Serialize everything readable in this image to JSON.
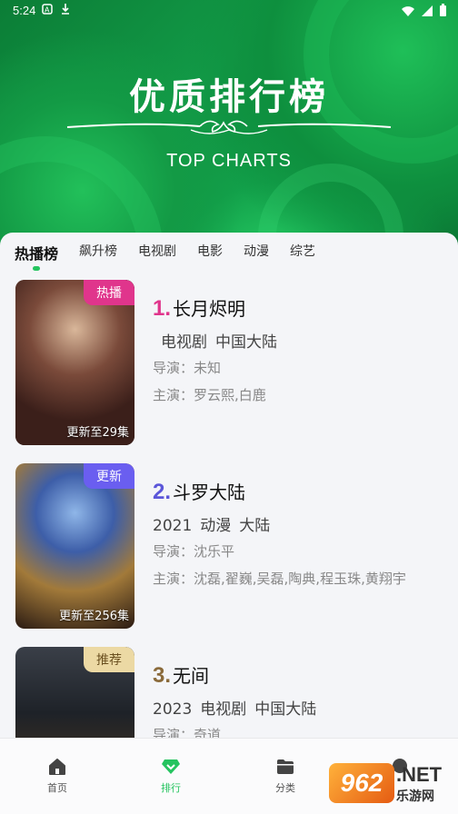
{
  "status_bar": {
    "time": "5:24"
  },
  "banner": {
    "title": "优质排行榜",
    "subtitle": "TOP CHARTS"
  },
  "tabs": [
    {
      "label": "热播榜",
      "active": true
    },
    {
      "label": "飙升榜",
      "active": false
    },
    {
      "label": "电视剧",
      "active": false
    },
    {
      "label": "电影",
      "active": false
    },
    {
      "label": "动漫",
      "active": false
    },
    {
      "label": "综艺",
      "active": false
    }
  ],
  "items": [
    {
      "rank": "1.",
      "title": "长月烬明",
      "rank_color": "#e0358c",
      "badge": "热播",
      "badge_color": "#e0358c",
      "update": "更新至29集",
      "meta": [
        "",
        "电视剧",
        "中国大陆"
      ],
      "director": "导演：未知",
      "cast": "主演：罗云熙,白鹿"
    },
    {
      "rank": "2.",
      "title": "斗罗大陆",
      "rank_color": "#5b56d9",
      "badge": "更新",
      "badge_color": "#6a5ef0",
      "update": "更新至256集",
      "meta": [
        "2021",
        "动漫",
        "大陆"
      ],
      "director": "导演：沈乐平",
      "cast": "主演：沈磊,翟巍,吴磊,陶典,程玉珠,黄翔宇"
    },
    {
      "rank": "3.",
      "title": "无间",
      "rank_color": "#8a6a3a",
      "badge": "推荐",
      "badge_color": "#e8d39a",
      "update": "",
      "meta": [
        "2023",
        "电视剧",
        "中国大陆"
      ],
      "director": "导演：奇道",
      "cast": ""
    }
  ],
  "bottom_nav": [
    {
      "label": "首页",
      "icon": "home-icon"
    },
    {
      "label": "排行",
      "icon": "diamond-icon",
      "active": true
    },
    {
      "label": "分类",
      "icon": "folder-icon"
    },
    {
      "label": "",
      "icon": "profile-icon"
    }
  ],
  "watermark": {
    "logo": "962",
    "net": ".NET",
    "text": "乐游网"
  }
}
